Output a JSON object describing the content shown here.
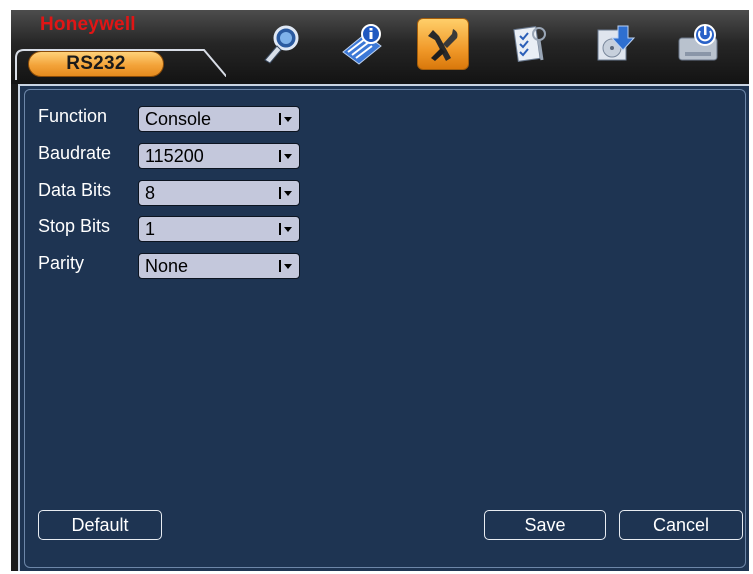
{
  "brand": {
    "logo": "Honeywell"
  },
  "tab": {
    "label": "RS232"
  },
  "toolbar": {
    "icons": [
      "search-icon",
      "info-icon",
      "settings-tools-icon",
      "advanced-checklist-icon",
      "backup-icon",
      "shutdown-icon"
    ],
    "active": "settings-tools-icon"
  },
  "form": {
    "function": {
      "label": "Function",
      "value": "Console"
    },
    "baudrate": {
      "label": "Baudrate",
      "value": "115200"
    },
    "data_bits": {
      "label": "Data Bits",
      "value": "8"
    },
    "stop_bits": {
      "label": "Stop Bits",
      "value": "1"
    },
    "parity": {
      "label": "Parity",
      "value": "None"
    }
  },
  "buttons": {
    "default": "Default",
    "save": "Save",
    "cancel": "Cancel"
  },
  "colors": {
    "panel_bg": "#1e3452",
    "accent_orange": "#f3a33a",
    "logo_red": "#e01515",
    "field_bg": "#c4c8dc"
  }
}
